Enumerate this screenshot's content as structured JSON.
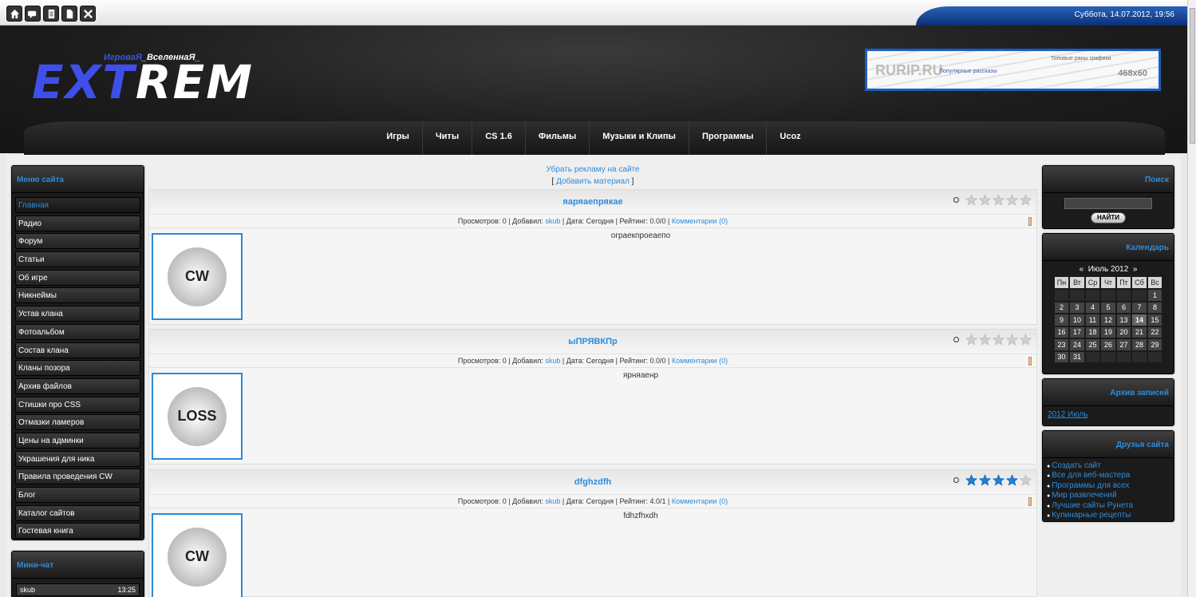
{
  "toolbar": {
    "buttons": [
      "home-icon",
      "chat-icon",
      "document-icon",
      "page-icon",
      "tools-icon"
    ],
    "datetime": "Суббота, 14.07.2012, 19:56"
  },
  "header": {
    "logo_subtitle_1": "ИгроваЯ",
    "logo_subtitle_2": "_ВселеннаЯ_",
    "logo_text_1": "EXT",
    "logo_text_2": "REM",
    "banner_title": "RURIP.RU",
    "banner_size": "468x60",
    "banner_link": "Популярные рассказы",
    "banner_text": "Топовые раны графики"
  },
  "nav": [
    "Игры",
    "Читы",
    "CS 1.6",
    "Фильмы",
    "Музыки и Клипы",
    "Программы",
    "Ucoz"
  ],
  "left_menu": {
    "title": "Меню сайта",
    "items": [
      "Главная",
      "Радио",
      "Форум",
      "Статьи",
      "Об игре",
      "Никнеймы",
      "Устав клана",
      "Фотоальбом",
      "Состав клана",
      "Кланы позора",
      "Архив файлов",
      "Стишки про CSS",
      "Отмазки ламеров",
      "Цены на админки",
      "Украшения для ника",
      "Правила проведения CW",
      "Блог",
      "Каталог сайтов",
      "Гостевая книга"
    ]
  },
  "minichat": {
    "title": "Мини-чат",
    "user": "skub",
    "time": "13:25"
  },
  "content": {
    "remove_ads": "Убрать рекламу на сайте",
    "add_bracket_open": "[ ",
    "add_material": "Добавить материал",
    "add_bracket_close": " ]",
    "entries": [
      {
        "title": "яаряаепрякае",
        "meta_prefix": "Просмотров: 0 | Добавил: ",
        "author": "skub",
        "meta_suffix": " | Дата: Сегодня | Рейтинг: 0.0/0 | ",
        "comments": "Комментарии (0)",
        "text": "ограекпроеаепо",
        "thumb_label": "CW",
        "stars": 0
      },
      {
        "title": "ыПРЯВКПр",
        "meta_prefix": "Просмотров: 0 | Добавил: ",
        "author": "skub",
        "meta_suffix": " | Дата: Сегодня | Рейтинг: 0.0/0 | ",
        "comments": "Комментарии (0)",
        "text": "ярняаенр",
        "thumb_label": "LOSS",
        "stars": 0
      },
      {
        "title": "dfghzdfh",
        "meta_prefix": "Просмотров: 0 | Добавил: ",
        "author": "skub",
        "meta_suffix": " | Дата: Сегодня | Рейтинг: 4.0/1 | ",
        "comments": "Комментарии (0)",
        "text": "fdhzfhxdh",
        "thumb_label": "CW",
        "stars": 4
      }
    ]
  },
  "search": {
    "title": "Поиск",
    "button": "НАЙТИ"
  },
  "calendar": {
    "title": "Календарь",
    "prev": "«",
    "month": "Июль 2012",
    "next": "»",
    "weekdays": [
      "Пн",
      "Вт",
      "Ср",
      "Чт",
      "Пт",
      "Сб",
      "Вс"
    ],
    "weeks": [
      [
        "",
        "",
        "",
        "",
        "",
        "",
        "1"
      ],
      [
        "2",
        "3",
        "4",
        "5",
        "6",
        "7",
        "8"
      ],
      [
        "9",
        "10",
        "11",
        "12",
        "13",
        "14",
        "15"
      ],
      [
        "16",
        "17",
        "18",
        "19",
        "20",
        "21",
        "22"
      ],
      [
        "23",
        "24",
        "25",
        "26",
        "27",
        "28",
        "29"
      ],
      [
        "30",
        "31",
        "",
        "",
        "",
        "",
        ""
      ]
    ],
    "today": "14"
  },
  "archive": {
    "title": "Архив записей",
    "item": "2012 Июль"
  },
  "friends": {
    "title": "Друзья сайта",
    "items": [
      "Создать сайт",
      "Все для веб-мастера",
      "Программы для всех",
      "Мир развлечений",
      "Лучшие сайты Рунета",
      "Кулинарные рецепты"
    ]
  },
  "colors": {
    "accent": "#2d8cdc",
    "logo_blue": "#3f4fe9",
    "star_filled": "#1f7fd8",
    "star_empty": "#cfcfcf"
  }
}
